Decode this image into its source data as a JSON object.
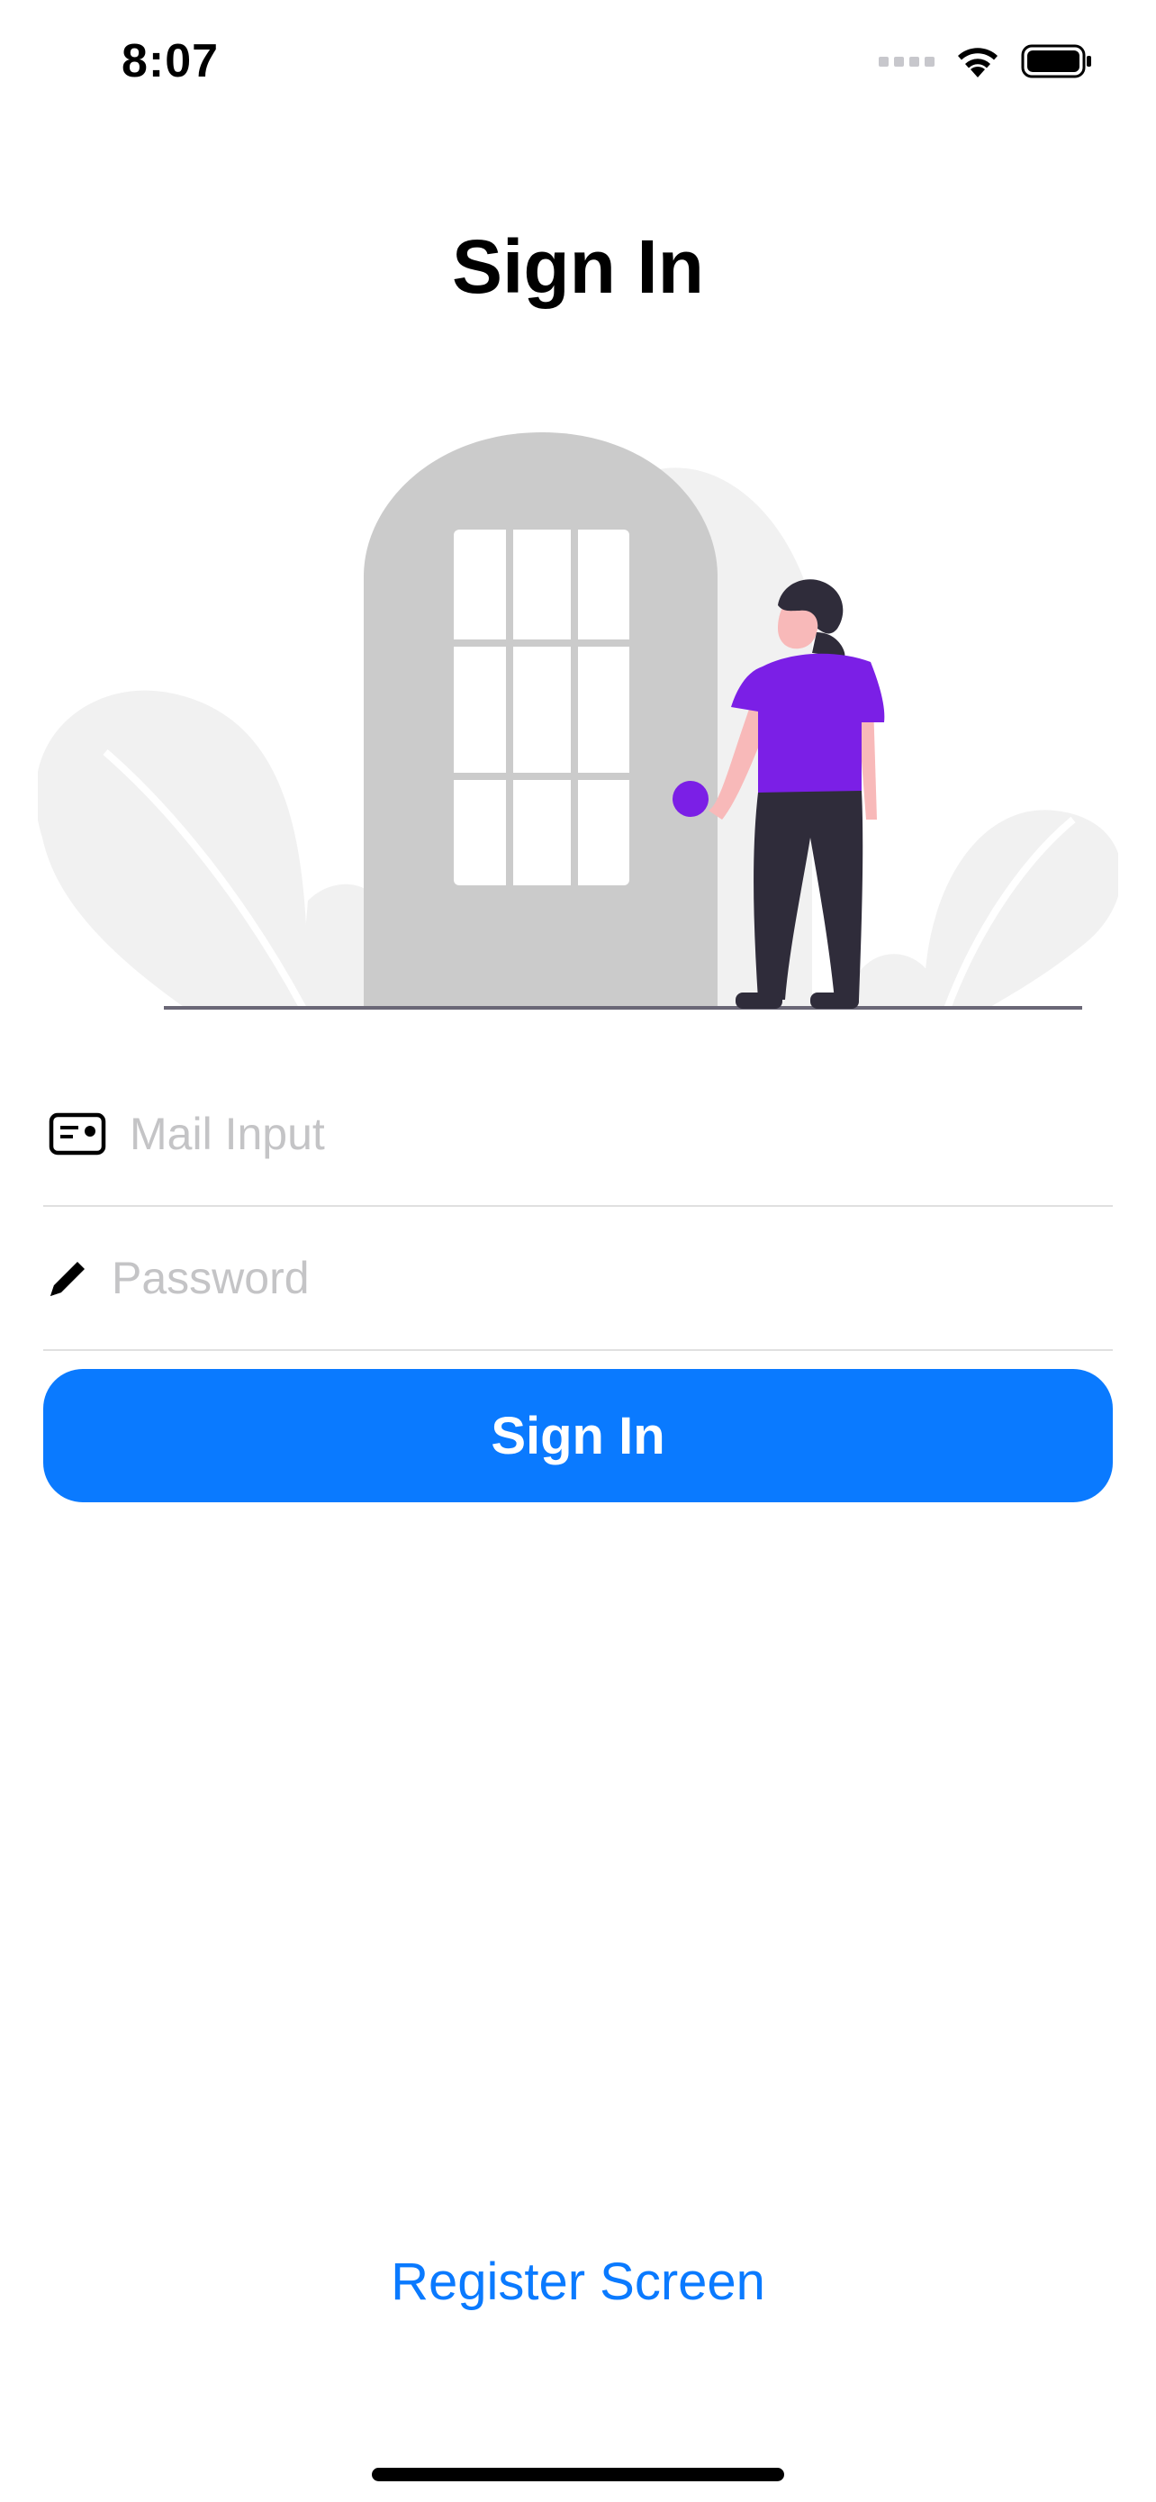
{
  "status_bar": {
    "time": "8:07"
  },
  "header": {
    "title": "Sign In"
  },
  "form": {
    "email": {
      "value": "",
      "placeholder": "Mail Input",
      "icon": "id-card-icon"
    },
    "password": {
      "value": "",
      "placeholder": "Password",
      "icon": "pencil-icon"
    },
    "submit_label": "Sign In"
  },
  "footer": {
    "register_label": "Register Screen"
  },
  "colors": {
    "accent": "#0a7aff",
    "figure_shirt": "#7b1fe6",
    "door": "#cbcbcb",
    "foliage": "#f1f1f1",
    "pants": "#2f2c3a"
  }
}
